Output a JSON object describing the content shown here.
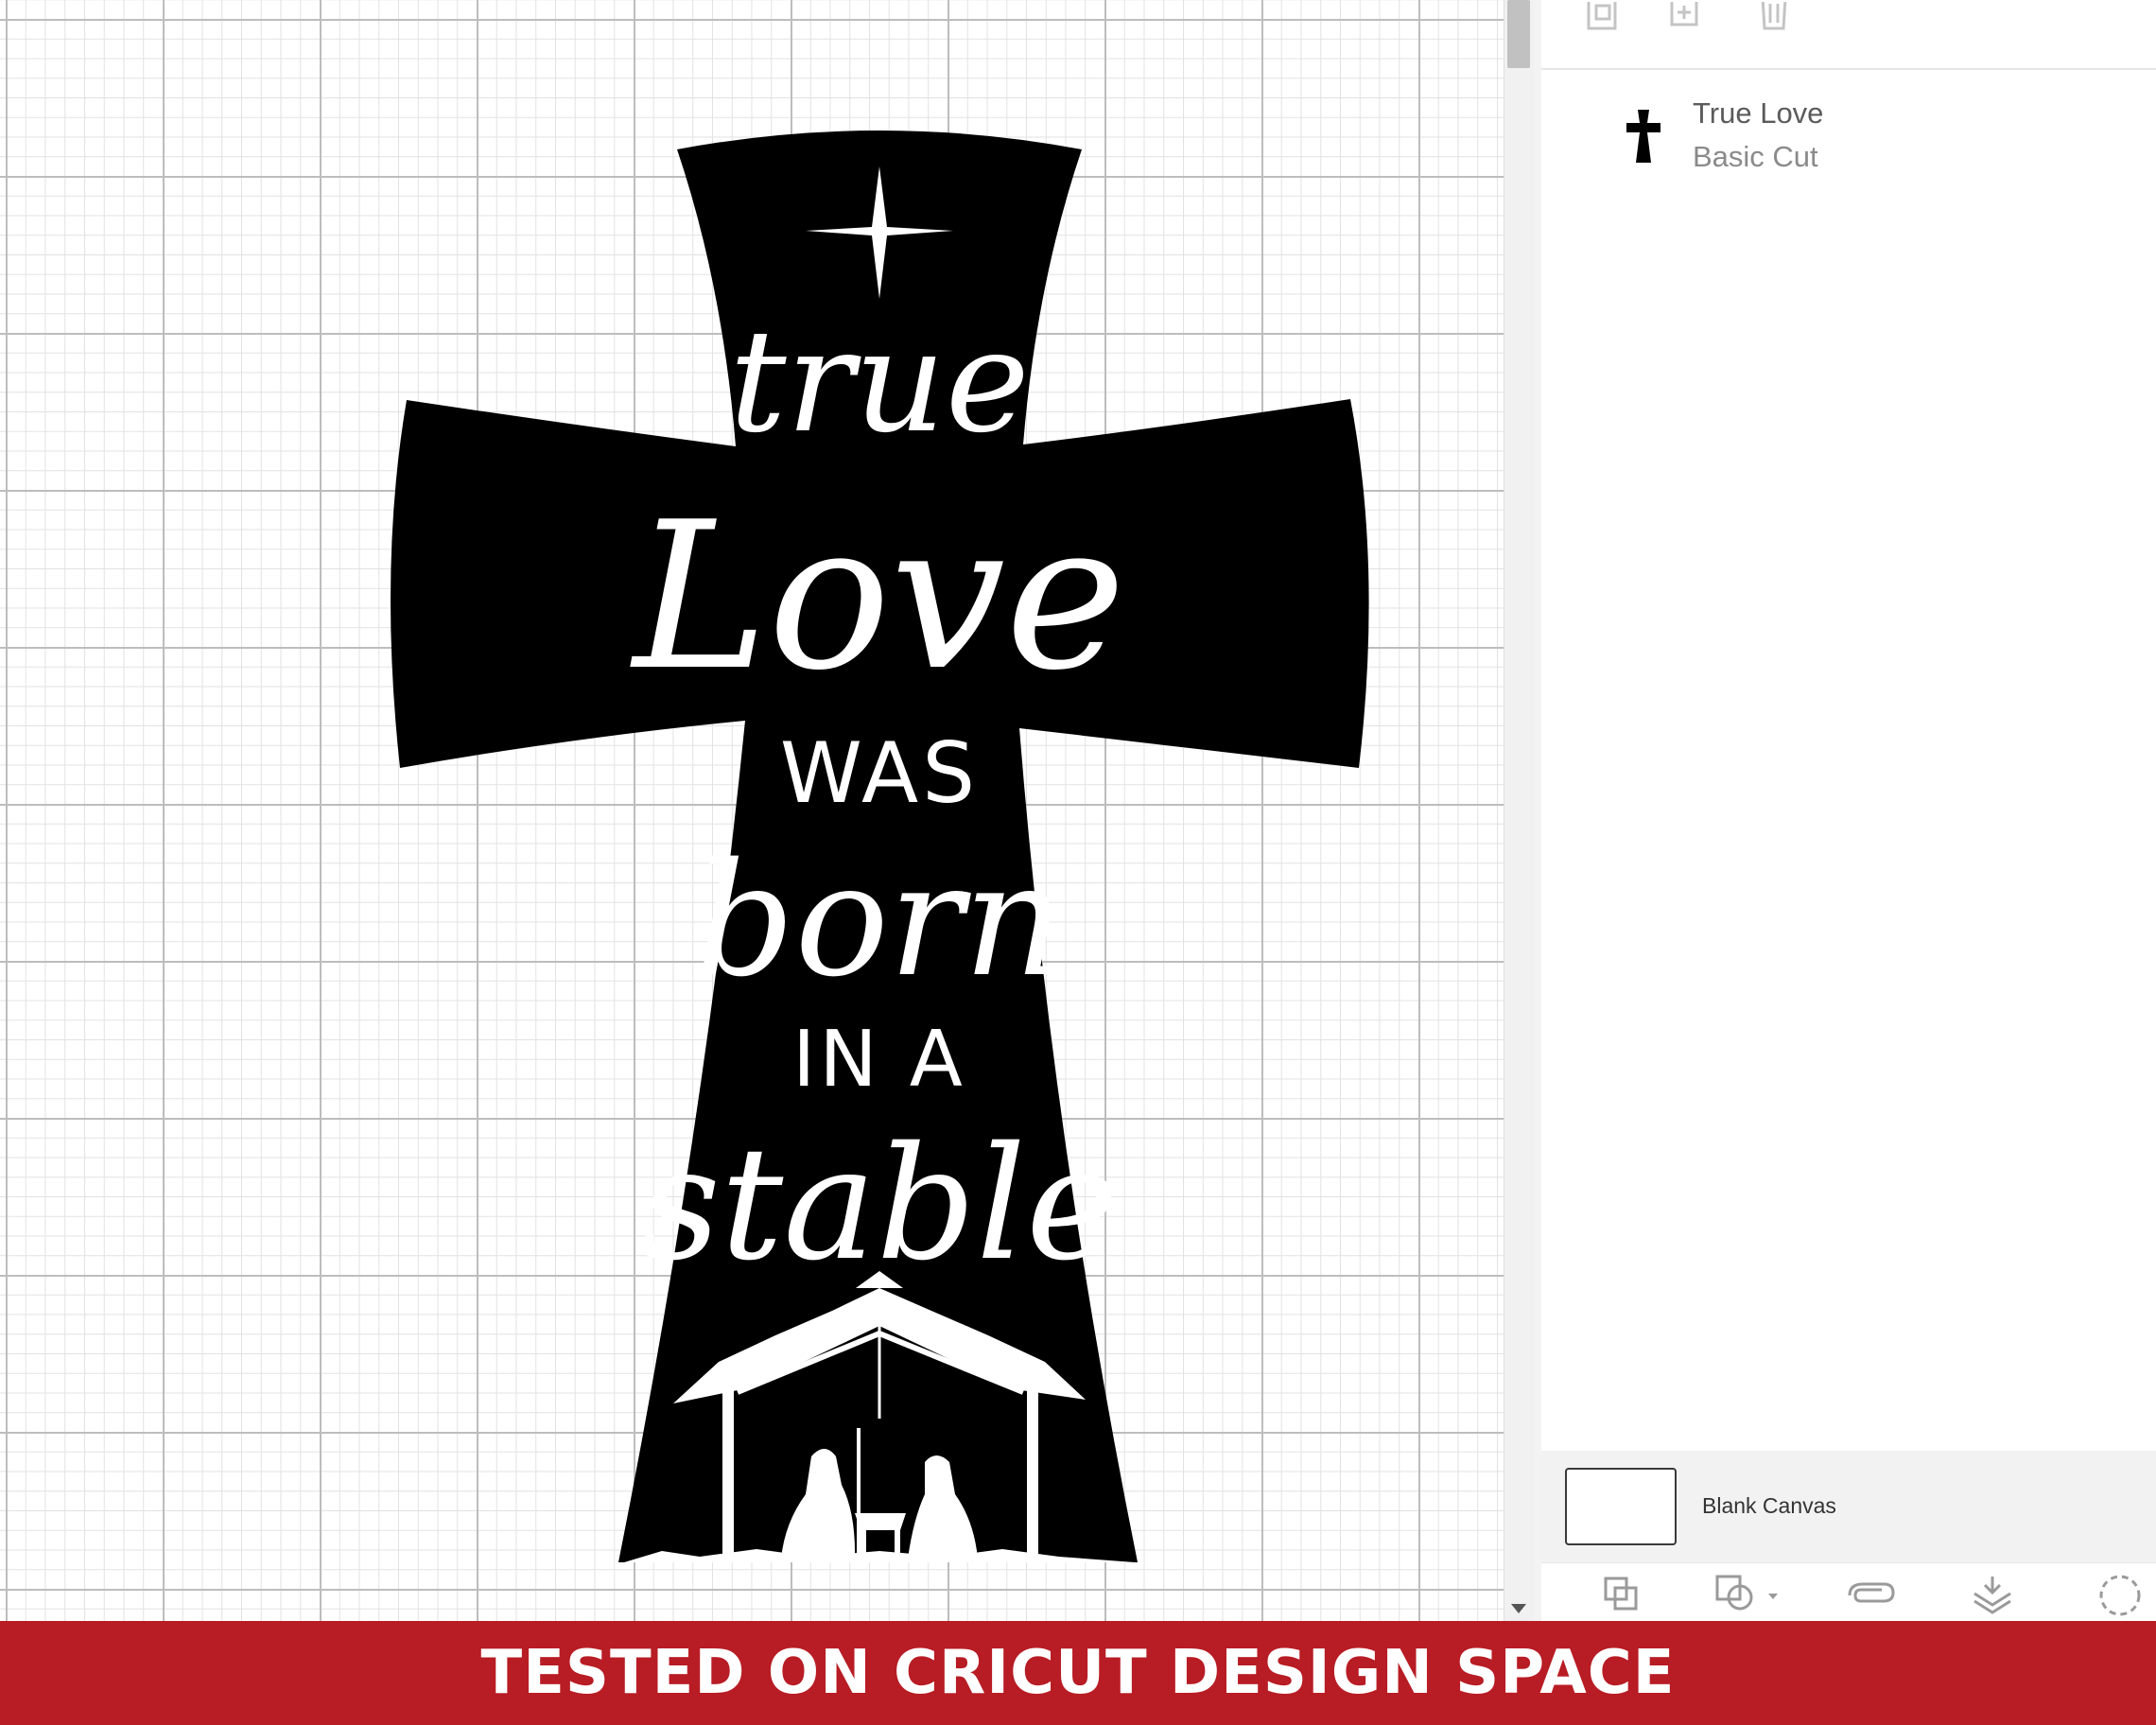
{
  "design": {
    "lines": [
      "true",
      "Love",
      "WAS",
      "born",
      "IN A",
      "stable"
    ]
  },
  "layers": {
    "items": [
      {
        "name": "True Love",
        "operation": "Basic Cut",
        "icon": "cross-icon"
      }
    ]
  },
  "canvas": {
    "label": "Blank Canvas"
  },
  "toolbar": {
    "top_icons": [
      "group-icon",
      "duplicate-icon",
      "delete-icon"
    ],
    "bottom_icons": [
      "slice-icon",
      "combine-icon",
      "attach-icon",
      "flatten-icon",
      "contour-icon"
    ]
  },
  "banner": {
    "text": "TESTED ON CRICUT DESIGN SPACE"
  },
  "colors": {
    "banner": "#b81c24",
    "design": "#000000",
    "grid": "#bdbdbd"
  }
}
